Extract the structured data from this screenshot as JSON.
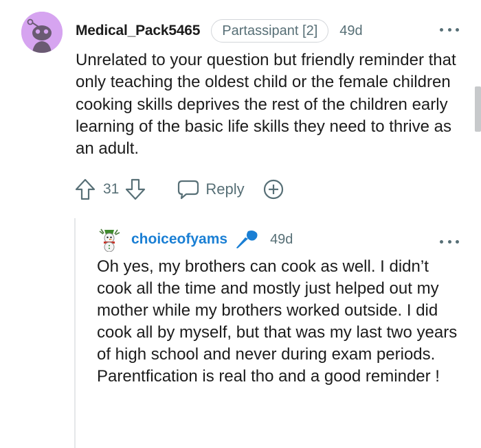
{
  "comment": {
    "username": "Medical_Pack5465",
    "flair": "Partassipant [2]",
    "age": "49d",
    "body": "Unrelated to your question but friendly reminder that only teaching the oldest child or the female children cooking skills deprives the rest of the children early learning of the basic life skills they need to thrive as an adult.",
    "vote_count": "31",
    "reply_label": "Reply",
    "avatar_color": "#d6a4f0"
  },
  "reply": {
    "username": "choiceofyams",
    "age": "49d",
    "body": "Oh yes, my brothers can cook as well. I didn’t cook all the time and mostly just helped out my mother while my brothers worked outside. I did cook all by myself, but that was my last two years of high school and never during exam periods. Parentfication is real tho and a good reminder !",
    "username_color": "#1a7fd4"
  },
  "icons": {
    "upvote": "arrow-up-icon",
    "downvote": "arrow-down-icon",
    "reply": "speech-bubble-icon",
    "award": "plus-circle-icon",
    "more": "ellipsis-icon",
    "mic": "microphone-icon"
  }
}
